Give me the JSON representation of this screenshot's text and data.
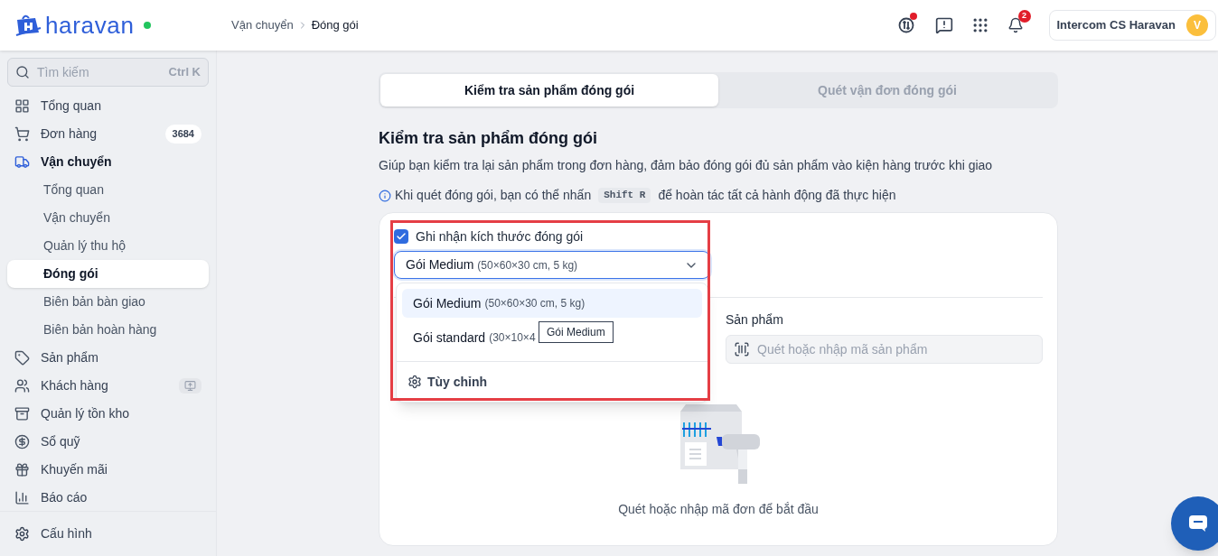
{
  "header": {
    "brand": "haravan",
    "breadcrumb": [
      {
        "label": "Vận chuyển"
      },
      {
        "label": "Đóng gói"
      }
    ],
    "notification_count": "2",
    "account": {
      "name": "Intercom CS Haravan",
      "initial": "V"
    }
  },
  "sidebar": {
    "search": {
      "placeholder": "Tìm kiếm",
      "shortcut": "Ctrl K"
    },
    "items": [
      {
        "label": "Tổng quan",
        "selected": false
      },
      {
        "label": "Đơn hàng",
        "badge": "3684",
        "selected": false
      },
      {
        "label": "Vận chuyển",
        "selected": true,
        "children": [
          {
            "label": "Tổng quan",
            "selected": false
          },
          {
            "label": "Vận chuyển",
            "selected": false
          },
          {
            "label": "Quản lý thu hộ",
            "selected": false
          },
          {
            "label": "Đóng gói",
            "selected": true
          },
          {
            "label": "Biên bản bàn giao",
            "selected": false
          },
          {
            "label": "Biên bản hoàn hàng",
            "selected": false
          }
        ]
      },
      {
        "label": "Sản phẩm",
        "selected": false
      },
      {
        "label": "Khách hàng",
        "selected": false,
        "extra": true
      },
      {
        "label": "Quản lý tồn kho",
        "selected": false
      },
      {
        "label": "Sổ quỹ",
        "selected": false
      },
      {
        "label": "Khuyến mãi",
        "selected": false
      },
      {
        "label": "Báo cáo",
        "selected": false
      }
    ],
    "footer": {
      "label": "Cấu hình"
    }
  },
  "tabs": [
    {
      "label": "Kiểm tra sản phẩm đóng gói",
      "selected": true
    },
    {
      "label": "Quét vận đơn đóng gói",
      "selected": false
    }
  ],
  "page": {
    "title": "Kiểm tra sản phẩm đóng gói",
    "description": "Giúp bạn kiểm tra lại sản phẩm trong đơn hàng, đảm bảo đóng gói đủ sản phẩm vào kiện hàng trước khi giao",
    "hint_before": "Khi quét đóng gói, bạn có thể nhấn",
    "hint_key": "Shift R",
    "hint_after": "để hoàn tác tất cả hành động đã thực hiện"
  },
  "card": {
    "record_size": {
      "label": "Ghi nhận kích thước đóng gói",
      "checked": true
    },
    "package_select": {
      "value": "Gói Medium",
      "detail": "(50×60×30 cm, 5 kg)",
      "expanded": true
    },
    "options": [
      {
        "name": "Gói Medium",
        "detail": "(50×60×30 cm, 5 kg)",
        "selected": true
      },
      {
        "name": "Gói standard",
        "detail": "(30×10×4",
        "selected": false
      }
    ],
    "customize": "Tùy chỉnh",
    "tooltip": "Gói Medium",
    "product": {
      "label": "Sản phẩm",
      "placeholder": "Quét hoặc nhập mã sản phẩm"
    },
    "empty_text": "Quét hoặc nhập mã đơn để bắt đầu"
  }
}
